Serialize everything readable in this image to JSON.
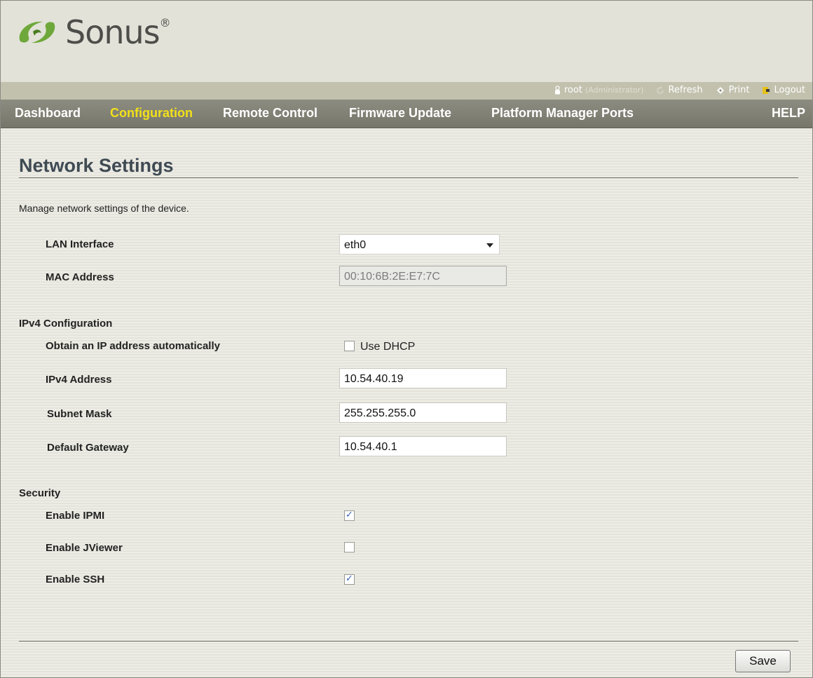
{
  "brand": {
    "name": "Sonus",
    "reg": "®"
  },
  "utility": {
    "user": "root",
    "role": "(Administrator)",
    "refresh": "Refresh",
    "print": "Print",
    "logout": "Logout"
  },
  "nav": {
    "items": [
      "Dashboard",
      "Configuration",
      "Remote Control",
      "Firmware Update",
      "Platform Manager Ports"
    ],
    "active": "Configuration",
    "help": "HELP",
    "active_color": "#f2e01a"
  },
  "page": {
    "title": "Network Settings",
    "description": "Manage network settings of the device."
  },
  "lan": {
    "interface_label": "LAN Interface",
    "interface_value": "eth0",
    "mac_label": "MAC Address",
    "mac_value": "00:10:6B:2E:E7:7C"
  },
  "ipv4": {
    "section": "IPv4 Configuration",
    "auto_label": "Obtain an IP address automatically",
    "dhcp_label": "Use DHCP",
    "dhcp_checked": false,
    "address_label": "IPv4 Address",
    "address_value": "10.54.40.19",
    "subnet_label": "Subnet Mask",
    "subnet_value": "255.255.255.0",
    "gateway_label": "Default Gateway",
    "gateway_value": "10.54.40.1"
  },
  "security": {
    "section": "Security",
    "ipmi_label": "Enable IPMI",
    "ipmi_checked": true,
    "jviewer_label": "Enable JViewer",
    "jviewer_checked": false,
    "ssh_label": "Enable SSH",
    "ssh_checked": true
  },
  "actions": {
    "save": "Save"
  }
}
